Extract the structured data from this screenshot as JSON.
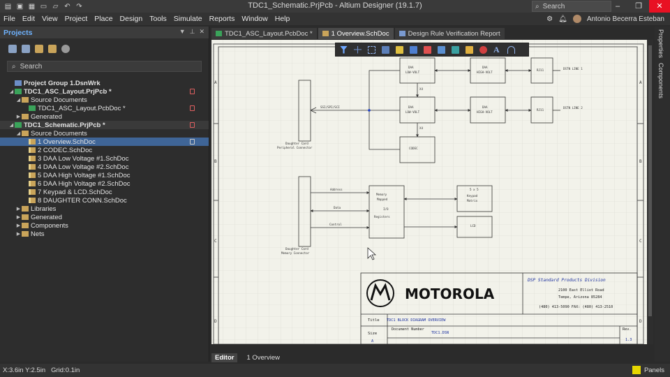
{
  "window": {
    "title": "TDC1_Schematic.PrjPcb - Altium Designer (19.1.7)",
    "search_placeholder": "Search"
  },
  "user": {
    "name": "Antonio Becerra Esteban"
  },
  "menu": [
    "File",
    "Edit",
    "View",
    "Project",
    "Place",
    "Design",
    "Tools",
    "Simulate",
    "Reports",
    "Window",
    "Help"
  ],
  "projects_panel": {
    "title": "Projects",
    "search_placeholder": "Search",
    "tree": [
      {
        "label": "Project Group 1.DsnWrk",
        "level": 0,
        "icon": "group",
        "bold": true
      },
      {
        "label": "TDC1_ASC_Layout.PrjPcb *",
        "level": 0,
        "icon": "project",
        "bold": true,
        "expanded": true,
        "mark": "red"
      },
      {
        "label": "Source Documents",
        "level": 1,
        "icon": "folder",
        "expanded": true
      },
      {
        "label": "TDC1_ASC_Layout.PcbDoc *",
        "level": 2,
        "icon": "pcb",
        "mark": "red"
      },
      {
        "label": "Generated",
        "level": 1,
        "icon": "folder",
        "collapsed": true
      },
      {
        "label": "TDC1_Schematic.PrjPcb *",
        "level": 0,
        "icon": "project",
        "bold": true,
        "expanded": true,
        "mark": "red",
        "highlight": true
      },
      {
        "label": "Source Documents",
        "level": 1,
        "icon": "folder",
        "expanded": true
      },
      {
        "label": "1 Overview.SchDoc",
        "level": 2,
        "icon": "sch",
        "selected": true,
        "mark": "white"
      },
      {
        "label": "2 CODEC.SchDoc",
        "level": 2,
        "icon": "sch"
      },
      {
        "label": "3 DAA Low Voltage #1.SchDoc",
        "level": 2,
        "icon": "sch"
      },
      {
        "label": "4 DAA Low Voltage #2.SchDoc",
        "level": 2,
        "icon": "sch"
      },
      {
        "label": "5 DAA High Voltage #1.SchDoc",
        "level": 2,
        "icon": "sch"
      },
      {
        "label": "6 DAA High Voltage #2.SchDoc",
        "level": 2,
        "icon": "sch"
      },
      {
        "label": "7 Keypad & LCD.SchDoc",
        "level": 2,
        "icon": "sch"
      },
      {
        "label": "8 DAUGHTER CONN.SchDoc",
        "level": 2,
        "icon": "sch"
      },
      {
        "label": "Libraries",
        "level": 1,
        "icon": "folder",
        "collapsed": true
      },
      {
        "label": "Generated",
        "level": 1,
        "icon": "folder",
        "collapsed": true
      },
      {
        "label": "Components",
        "level": 1,
        "icon": "folder",
        "collapsed": true
      },
      {
        "label": "Nets",
        "level": 1,
        "icon": "folder",
        "collapsed": true
      }
    ]
  },
  "doc_tabs": [
    {
      "label": "TDC1_ASC_Layout.PcbDoc *",
      "icon": "pcb"
    },
    {
      "label": "1 Overview.SchDoc",
      "icon": "sch",
      "active": true
    },
    {
      "label": "Design Rule Verification Report",
      "icon": "report"
    }
  ],
  "right_panels": [
    "Properties",
    "Components"
  ],
  "bottom_tabs": [
    "Editor",
    "1 Overview"
  ],
  "status": {
    "coords": "X:3.6in Y:2.5in",
    "grid": "Grid:0.1in",
    "panels": "Panels"
  },
  "schematic": {
    "zones": [
      "A",
      "B",
      "C",
      "D"
    ],
    "blocks": {
      "daa1": "DAA",
      "daa1_sub": "LOW-VOLT",
      "daa2": "DAA",
      "daa2_sub": "LOW-VOLT",
      "dah1": "DAA",
      "dah1_sub": "HIGH-VOLT",
      "dah2": "DAA",
      "dah2_sub": "HIGH-VOLT",
      "rj1": "RJ11",
      "rj2": "RJ11",
      "codec": "CODEC",
      "line1": "DSTN LINE 1",
      "line2": "DSTN LINE 2",
      "conn1": "Daughter Card",
      "conn1b": "Peripheral Connector",
      "conn2": "Daughter Card",
      "conn2b": "Memory Connector",
      "bus": "SSI/SPI/SCI",
      "mem1": "Memory",
      "mem2": "Mapped",
      "mem3": "I/O",
      "mem4": "Registers",
      "keypad1": "5 x 5",
      "keypad2": "Keypad",
      "keypad3": "Matrix",
      "lcd": "LCD",
      "addr": "Address",
      "data": "Data",
      "ctrl": "Control",
      "x1": "X4",
      "x2": "X4"
    },
    "titleblock": {
      "company": "MOTOROLA",
      "division": "DSP Standard Products Division",
      "addr1": "2100 East Elliot Road",
      "addr2": "Tempe, Arizona 85284",
      "phone": "(480) 413-5090   FAX: (480) 413-2510",
      "title_label": "Title",
      "title": "TDC1 BLOCK DIAGRAM OVERVIEW",
      "size_label": "Size",
      "size": "A",
      "docnum_label": "Document Number",
      "docnum": "TDC1.DSN",
      "rev_label": "Rev.",
      "rev": "1.3"
    }
  }
}
